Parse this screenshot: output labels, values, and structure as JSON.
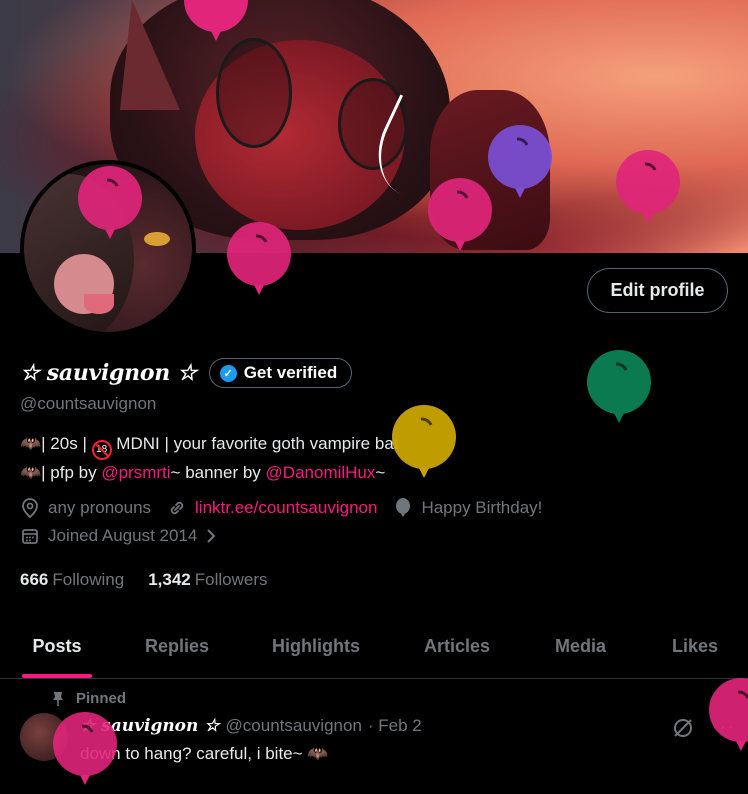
{
  "profile": {
    "display_name": "☆ sauvignon ☆",
    "handle": "@countsauvignon",
    "edit_label": "Edit profile",
    "verify_label": "Get verified",
    "bio_line1_pre": "🦇| 20s | ",
    "bio_age": "18",
    "bio_line1_post": " MDNI | your favorite goth vampire bat",
    "bio_line2_pre": "🦇| pfp by ",
    "bio_pfp_link": "@prsmrti",
    "bio_line2_mid": "~ banner by ",
    "bio_banner_link": "@DanomilHux",
    "bio_line2_post": "~",
    "pronouns": "any pronouns",
    "website": "linktr.ee/countsauvignon",
    "birthday": "Happy Birthday!",
    "joined": "Joined August 2014",
    "following_count": "666",
    "following_label": "Following",
    "followers_count": "1,342",
    "followers_label": "Followers"
  },
  "tabs": [
    {
      "label": "Posts",
      "active": true
    },
    {
      "label": "Replies"
    },
    {
      "label": "Highlights"
    },
    {
      "label": "Articles"
    },
    {
      "label": "Media"
    },
    {
      "label": "Likes"
    }
  ],
  "pinned_post": {
    "pinned_label": "Pinned",
    "author": "☆ sauvignon ☆",
    "handle": "@countsauvignon",
    "date": "· Feb 2",
    "text": "down to hang? careful, i bite~ 🦇"
  },
  "colors": {
    "accent": "#f91880",
    "muted": "#71767b",
    "balloon_pink": "#e0257a",
    "balloon_purple": "#7b4fd6",
    "balloon_green": "#0b7a50",
    "balloon_yellow": "#c9a400"
  },
  "icons": [
    "location-icon",
    "link-icon",
    "balloon-icon",
    "calendar-icon",
    "chevron-right-icon",
    "pin-icon",
    "grok-icon",
    "more-icon",
    "verified-check-icon"
  ]
}
